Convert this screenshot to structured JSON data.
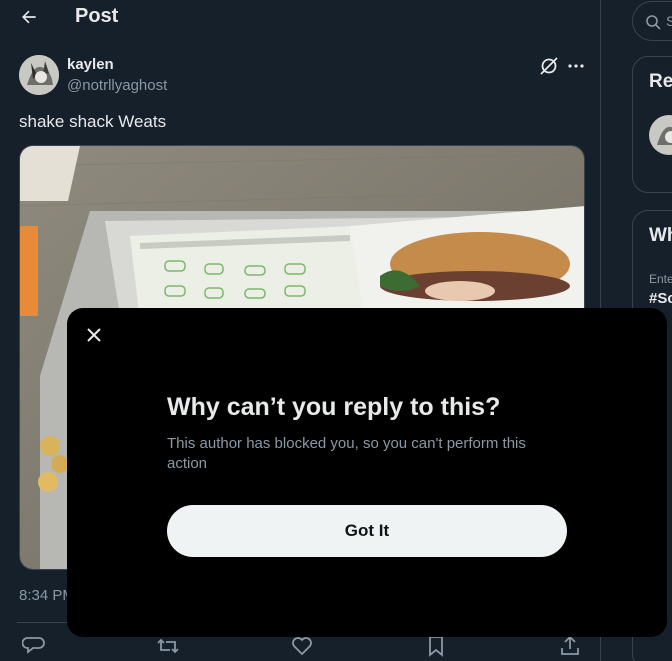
{
  "header": {
    "title": "Post",
    "back_icon": "arrow-left-icon"
  },
  "post": {
    "author_name": "kaylen",
    "author_handle": "@notrllyaghost",
    "text": "shake shack Weats",
    "timestamp": "8:34 PM",
    "image_alt": "burger on a tray"
  },
  "sidebar": {
    "search_placeholder": "S",
    "panel1_title": "Re",
    "panel2_title": "Wh",
    "trend_context": "Ente",
    "trend_name": "#Sc"
  },
  "modal": {
    "title": "Why can’t you reply to this?",
    "description": "This author has blocked you, so you can't perform this action",
    "button_label": "Got It"
  },
  "colors": {
    "background": "#15202b",
    "modal_bg": "#000000",
    "button_bg": "#eff3f4",
    "muted_text": "#8b98a5",
    "border": "#38444d"
  }
}
